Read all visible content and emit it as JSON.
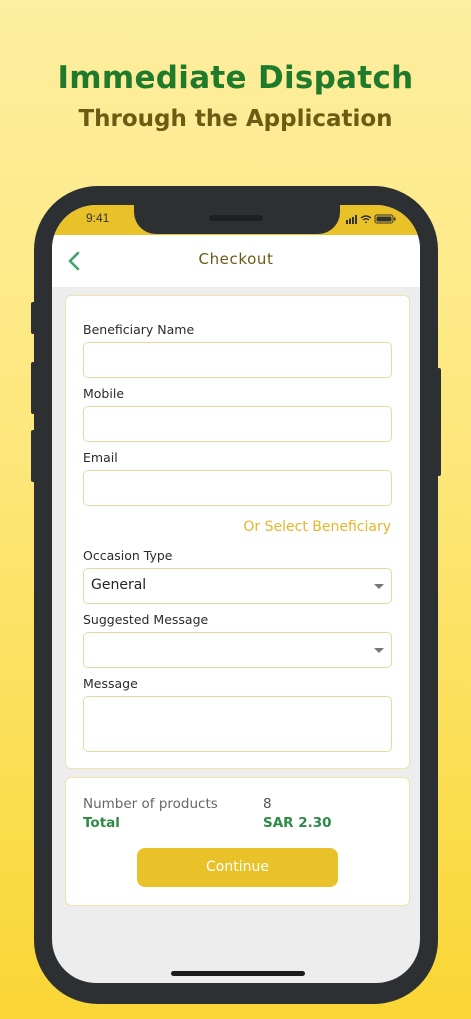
{
  "promo": {
    "headline": "Immediate Dispatch",
    "subheadline": "Through the Application"
  },
  "status_bar": {
    "time": "9:41"
  },
  "nav": {
    "title": "Checkout",
    "back_icon": "chevron-left-icon"
  },
  "form": {
    "beneficiary_name_label": "Beneficiary Name",
    "beneficiary_name_value": "",
    "mobile_label": "Mobile",
    "mobile_value": "",
    "email_label": "Email",
    "email_value": "",
    "select_beneficiary_link": "Or Select Beneficiary",
    "occasion_type_label": "Occasion Type",
    "occasion_type_value": "General",
    "suggested_message_label": "Suggested Message",
    "suggested_message_value": "",
    "message_label": "Message",
    "message_value": ""
  },
  "summary": {
    "products_label": "Number of products",
    "products_value": "8",
    "total_label": "Total",
    "total_value": "SAR 2.30",
    "continue_label": "Continue"
  },
  "colors": {
    "accent_yellow": "#e9c22a",
    "brand_green": "#1f7a2c",
    "total_green": "#2d8b48",
    "title_brown": "#6b5a14"
  }
}
